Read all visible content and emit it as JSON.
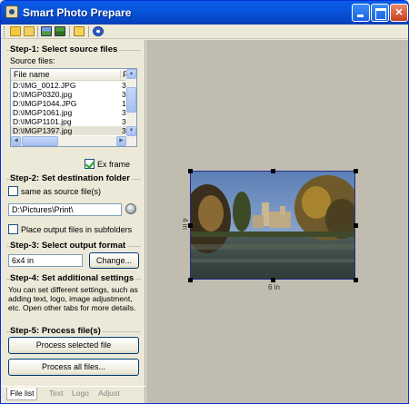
{
  "window": {
    "title": "Smart Photo Prepare"
  },
  "toolbar": {
    "icons": [
      "open-folder-icon",
      "open-file-icon",
      "image-icon",
      "save-image-icon",
      "checklist-icon",
      "help-icon"
    ]
  },
  "step1": {
    "title": "Step-1: Select source files",
    "source_label": "Source files:",
    "columns": [
      "File name",
      "F"
    ],
    "files": [
      {
        "name": "D:\\IMG_0012.JPG",
        "size": "3"
      },
      {
        "name": "D:\\IMGP0320.jpg",
        "size": "3"
      },
      {
        "name": "D:\\IMGP1044.JPG",
        "size": "1"
      },
      {
        "name": "D:\\IMGP1061.jpg",
        "size": "3"
      },
      {
        "name": "D:\\IMGP1101.jpg",
        "size": "3"
      },
      {
        "name": "D:\\IMGP1397.jpg",
        "size": "3"
      }
    ],
    "frame_label": "Ex frame",
    "frame_checked": true
  },
  "step2": {
    "title": "Step-2: Set destination folder",
    "same_as_source_label": "same as source file(s)",
    "same_as_source_checked": false,
    "path": "D:\\Pictures\\Print\\",
    "subfolder_label": "Place output files in subfolders",
    "subfolder_checked": false
  },
  "step3": {
    "title": "Step-3: Select output format",
    "format": "6x4 in",
    "change_label": "Change..."
  },
  "step4": {
    "title": "Step-4: Set additional settings",
    "description": "You can set different settings, such as adding text, logo, image adjustment, etc. Open other tabs for more details."
  },
  "step5": {
    "title": "Step-5: Process file(s)",
    "process_selected_label": "Process selected file",
    "process_all_label": "Process all files..."
  },
  "tabs": [
    "File list",
    "Text",
    "Logo",
    "Adjust"
  ],
  "preview": {
    "height_label": "4 in",
    "width_label": "6 in"
  },
  "colors": {
    "titlebar": "#0a5ce8",
    "preview_bg": "#c0bdb0",
    "selection_border": "#2b2b8a"
  }
}
